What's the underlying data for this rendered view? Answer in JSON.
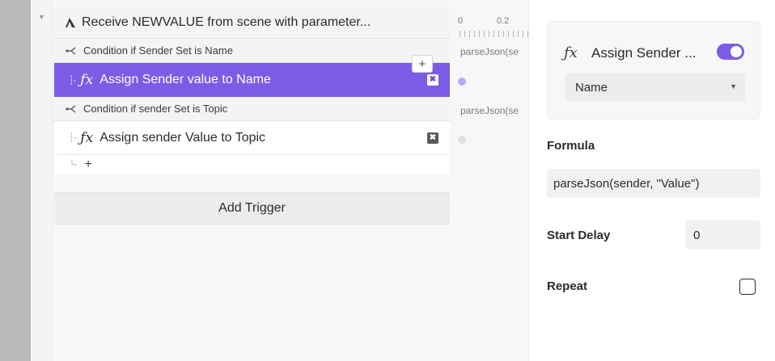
{
  "trigger": {
    "label": "Receive NEWVALUE from scene with parameter...",
    "icon": "trigger-icon"
  },
  "rows": [
    {
      "type": "condition",
      "label": "Condition if Sender Set is Name",
      "icon": "branch-icon"
    },
    {
      "type": "action",
      "label": "Assign Sender value to Name",
      "icon": "fx-icon",
      "selected": true
    },
    {
      "type": "condition",
      "label": "Condition if sender Set is Topic",
      "icon": "branch-icon"
    },
    {
      "type": "action",
      "label": "Assign sender Value to Topic",
      "icon": "fx-icon",
      "selected": false
    }
  ],
  "add_symbol": "+",
  "delete_symbol": "✖",
  "add_trigger_label": "Add Trigger",
  "timeline": {
    "ticks": [
      "0",
      "0.2"
    ],
    "row_texts": [
      "parseJson(se",
      "parseJson(se"
    ]
  },
  "panel": {
    "action_title": "Assign Sender ...",
    "fx_glyph": "ƒx",
    "enabled": true,
    "target_select": "Name",
    "formula_label": "Formula",
    "formula_value": "parseJson(sender, \"Value\")",
    "start_delay_label": "Start Delay",
    "start_delay_value": "0",
    "repeat_label": "Repeat",
    "repeat_checked": false
  },
  "colors": {
    "accent": "#7c5ce6",
    "gutter": "#b9b9bc"
  }
}
